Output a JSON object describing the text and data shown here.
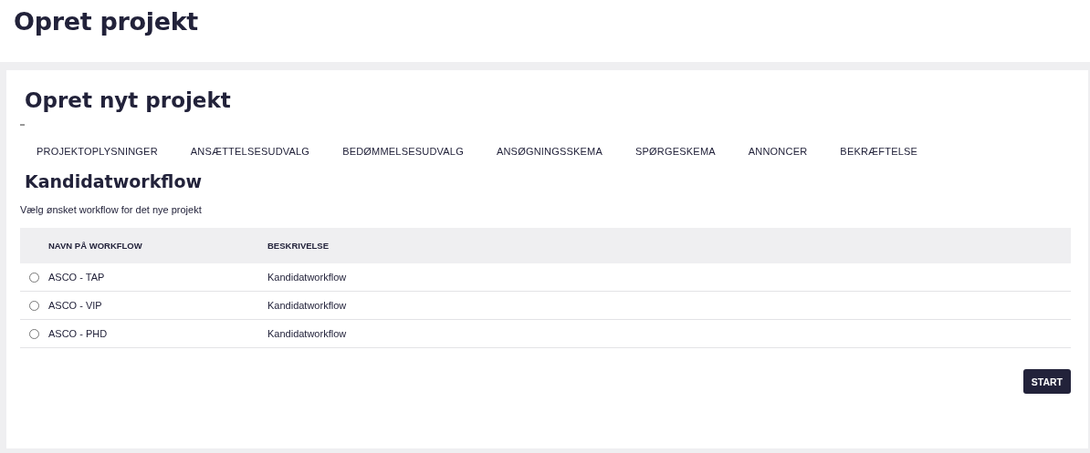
{
  "page_title": "Opret projekt",
  "card": {
    "title": "Opret nyt projekt",
    "steps": [
      {
        "label": "PROJEKTOPLYSNINGER",
        "selected": false
      },
      {
        "label": "ANSÆTTELSESUDVALG",
        "selected": false
      },
      {
        "label": "BEDØMMELSESUDVALG",
        "selected": false
      },
      {
        "label": "ANSØGNINGSSKEMA",
        "selected": false
      },
      {
        "label": "SPØRGESKEMA",
        "selected": false
      },
      {
        "label": "ANNONCER",
        "selected": false
      },
      {
        "label": "BEKRÆFTELSE",
        "selected": false
      }
    ],
    "section_title": "Kandidatworkflow",
    "instruction": "Vælg ønsket workflow for det nye projekt",
    "table": {
      "columns": [
        "NAVN PÅ WORKFLOW",
        "BESKRIVELSE"
      ],
      "rows": [
        {
          "name": "ASCO - TAP",
          "description": "Kandidatworkflow",
          "selected": false
        },
        {
          "name": "ASCO - VIP",
          "description": "Kandidatworkflow",
          "selected": false
        },
        {
          "name": "ASCO - PHD",
          "description": "Kandidatworkflow",
          "selected": false
        }
      ]
    },
    "button": "START"
  }
}
